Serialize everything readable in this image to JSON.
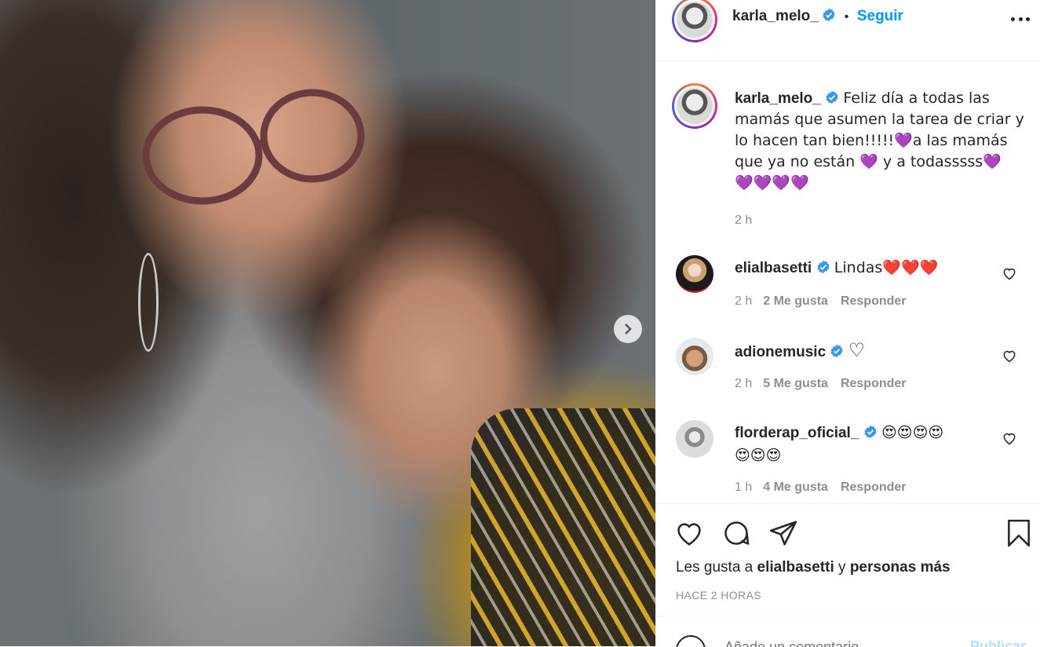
{
  "post": {
    "author": "karla_melo_",
    "follow_label": "Seguir",
    "separator": "•",
    "caption_lines": [
      "Feliz día a todas las",
      "mamás que asumen la tarea de criar y",
      "lo hacen tan bien!!!!!💜a las mamás",
      "que ya no están 💜 y a todasssss💜",
      "💜💜💜💜"
    ],
    "caption_time": "2 h"
  },
  "comments": [
    {
      "user": "elialbasetti",
      "text": "Lindas❤️❤️❤️",
      "time": "2 h",
      "likes": "2 Me gusta",
      "reply": "Responder"
    },
    {
      "user": "adionemusic",
      "text": "♡",
      "time": "2 h",
      "likes": "5 Me gusta",
      "reply": "Responder"
    },
    {
      "user": "florderap_oficial_",
      "text": "😍😍😍😍",
      "text2": "😍😍😍",
      "time": "1 h",
      "likes": "4 Me gusta",
      "reply": "Responder"
    }
  ],
  "footer": {
    "likes_prefix": "Les gusta a",
    "likes_user": "elialbasetti",
    "likes_and": "y",
    "likes_rest": "personas más",
    "posted_ago": "HACE 2 HORAS",
    "add_comment_placeholder": "Añade un comentario...",
    "publish_label": "Publicar"
  },
  "colors": {
    "accent": "#0095f6",
    "muted": "#8e8e8e",
    "text": "#262626"
  },
  "icons": [
    "verified-badge-icon",
    "more-options-icon",
    "heart-icon",
    "comment-icon",
    "share-icon",
    "bookmark-icon",
    "next-arrow-icon",
    "emoji-icon"
  ]
}
